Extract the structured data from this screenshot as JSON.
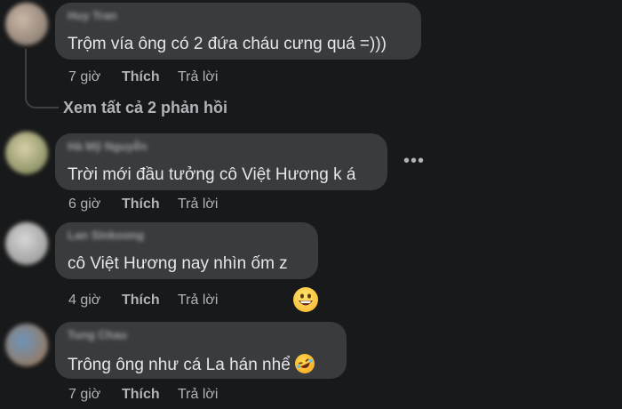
{
  "comments": [
    {
      "author": "Huy Tran",
      "text": "Trộm vía ông có 2 đứa cháu cưng quá =)))",
      "time": "7 giờ",
      "like_label": "Thích",
      "reply_label": "Trả lời",
      "view_replies": "Xem tất cả 2 phản hồi"
    },
    {
      "author": "Hà Mỹ Nguyễn",
      "text": "Trời mới đầu tưởng cô Việt Hương k á",
      "time": "6 giờ",
      "like_label": "Thích",
      "reply_label": "Trả lời",
      "more_icon": "ellipsis-icon"
    },
    {
      "author": "Lan Sinkoong",
      "text": "cô Việt Hương nay nhìn ốm z",
      "time": "4 giờ",
      "like_label": "Thích",
      "reply_label": "Trả lời",
      "reaction_icon": "grinning-face-icon"
    },
    {
      "author": "Tung Chau",
      "text": "Trông ông như cá La hán nhể",
      "time": "7 giờ",
      "like_label": "Thích",
      "reply_label": "Trả lời",
      "inline_emoji": "rolling-laughing-icon"
    }
  ],
  "colors": {
    "background": "#18191a",
    "bubble": "#3a3b3c",
    "text": "#e4e6eb",
    "secondary": "#b0b3b8"
  }
}
